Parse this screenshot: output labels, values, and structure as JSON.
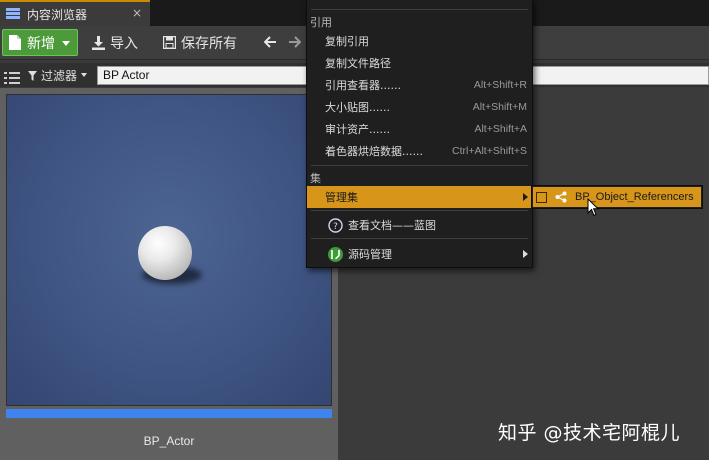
{
  "tab": {
    "title": "内容浏览器",
    "close": "×"
  },
  "toolbar": {
    "new_label": "新增",
    "import_label": "导入",
    "save_all_label": "保存所有",
    "back": "🡐",
    "forward": "🡒"
  },
  "filter": {
    "label": "过滤器",
    "search_value": "BP Actor"
  },
  "asset": {
    "name": "BP_Actor"
  },
  "menu": {
    "section_references": "引用",
    "items": [
      {
        "label": "复制引用",
        "shortcut": ""
      },
      {
        "label": "复制文件路径",
        "shortcut": ""
      },
      {
        "label": "引用查看器......",
        "shortcut": "Alt+Shift+R"
      },
      {
        "label": "大小贴图......",
        "shortcut": "Alt+Shift+M"
      },
      {
        "label": "审计资产......",
        "shortcut": "Alt+Shift+A"
      },
      {
        "label": "着色器烘焙数据......",
        "shortcut": "Ctrl+Alt+Shift+S"
      }
    ],
    "section_collections": "集",
    "manage_collections": "管理集",
    "view_docs": "查看文档——蓝图",
    "source_control": "源码管理"
  },
  "submenu": {
    "item": "BP_Object_Referencers"
  },
  "watermark": "知乎 @技术宅阿棍儿",
  "colors": {
    "accent_orange": "#d7961a",
    "new_button_green": "#4c9a3a",
    "thumbnail_blue": "#3f5583",
    "progress_blue": "#3f84ee"
  },
  "icons": [
    "content-browser-icon",
    "new-file-icon",
    "import-icon",
    "save-icon",
    "back-arrow-icon",
    "forward-arrow-icon",
    "filter-icon",
    "help-icon",
    "source-control-icon",
    "share-icon",
    "mouse-cursor-icon"
  ]
}
